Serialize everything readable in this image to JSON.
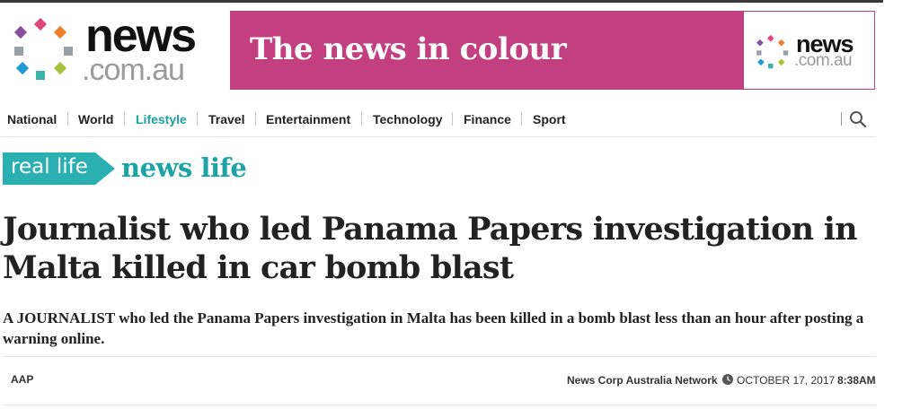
{
  "logo": {
    "name": "news",
    "domain": ".com.au"
  },
  "banner": {
    "text": "The news in colour",
    "logo_name": "news",
    "logo_domain": ".com.au"
  },
  "nav": {
    "items": [
      {
        "label": "National"
      },
      {
        "label": "World"
      },
      {
        "label": "Lifestyle",
        "active": true
      },
      {
        "label": "Travel"
      },
      {
        "label": "Entertainment"
      },
      {
        "label": "Technology"
      },
      {
        "label": "Finance"
      },
      {
        "label": "Sport"
      }
    ],
    "search_icon": "search-icon"
  },
  "section": {
    "tag": "real life",
    "name": "news life"
  },
  "article": {
    "headline": "Journalist who led Panama Papers investigation in Malta killed in car bomb blast",
    "standfirst": "A JOURNALIST who led the Panama Papers investigation in Malta has been killed in a bomb blast less than an hour after posting a warning online.",
    "byline": "AAP",
    "source": "News Corp Australia Network",
    "date": "OCTOBER 17, 2017",
    "time": "8:38AM"
  },
  "colors": {
    "accent": "#1ba3a5",
    "tag_bg": "#2bb0b2",
    "banner_bg": "#c2407f",
    "logo_dots": [
      "#e0457b",
      "#f07d2a",
      "#8c4fa0",
      "#9aa0a6",
      "#1e9bd7",
      "#3bb3a8",
      "#a6c23a"
    ]
  }
}
